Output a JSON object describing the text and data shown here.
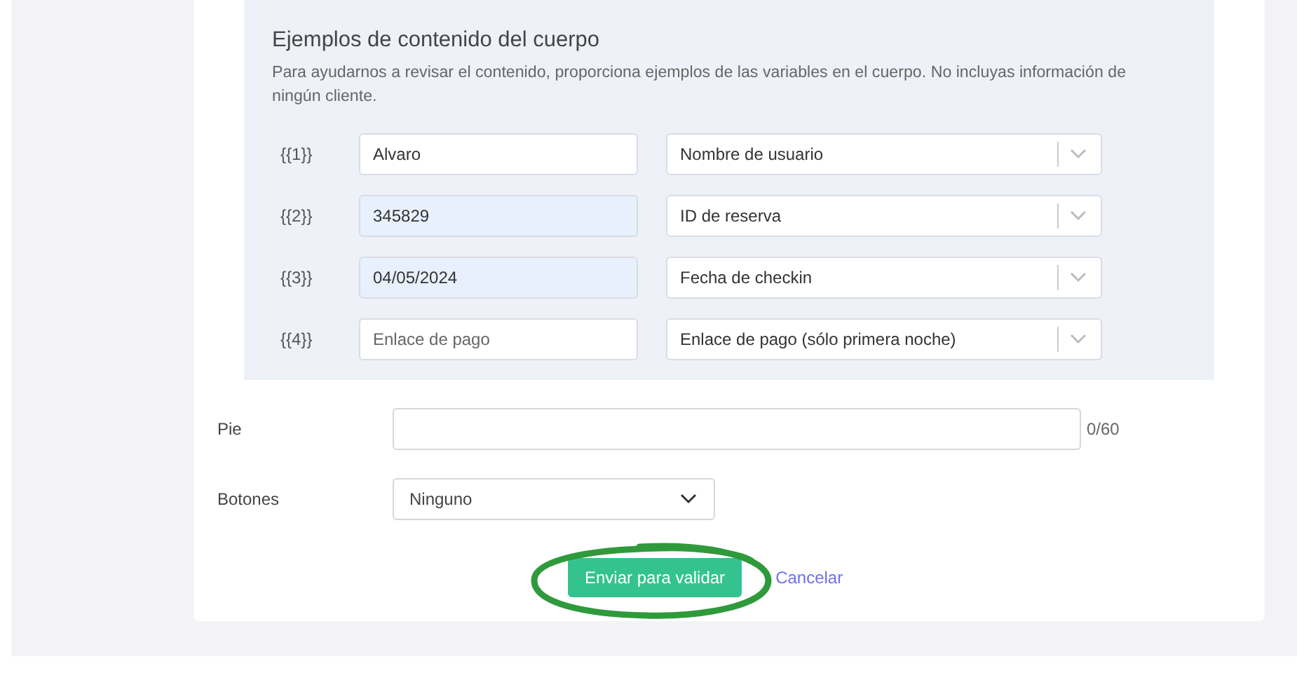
{
  "examples": {
    "title": "Ejemplos de contenido del cuerpo",
    "description": "Para ayudarnos a revisar el contenido, proporciona ejemplos de las variables en el cuerpo. No incluyas información de ningún cliente.",
    "variables": [
      {
        "tag": "{{1}}",
        "value": "Alvaro",
        "autofilled": false,
        "field": "Nombre de usuario"
      },
      {
        "tag": "{{2}}",
        "value": "345829",
        "autofilled": true,
        "field": "ID de reserva"
      },
      {
        "tag": "{{3}}",
        "value": "04/05/2024",
        "autofilled": true,
        "field": "Fecha de checkin"
      },
      {
        "tag": "{{4}}",
        "placeholder": "Enlace de pago",
        "autofilled": false,
        "field": "Enlace de pago (sólo primera noche)"
      }
    ]
  },
  "footer": {
    "label": "Pie",
    "counter": "0/60"
  },
  "buttons_field": {
    "label": "Botones",
    "value": "Ninguno"
  },
  "actions": {
    "submit": "Enviar para validar",
    "cancel": "Cancelar"
  },
  "annotation": {
    "kind": "ellipse"
  }
}
